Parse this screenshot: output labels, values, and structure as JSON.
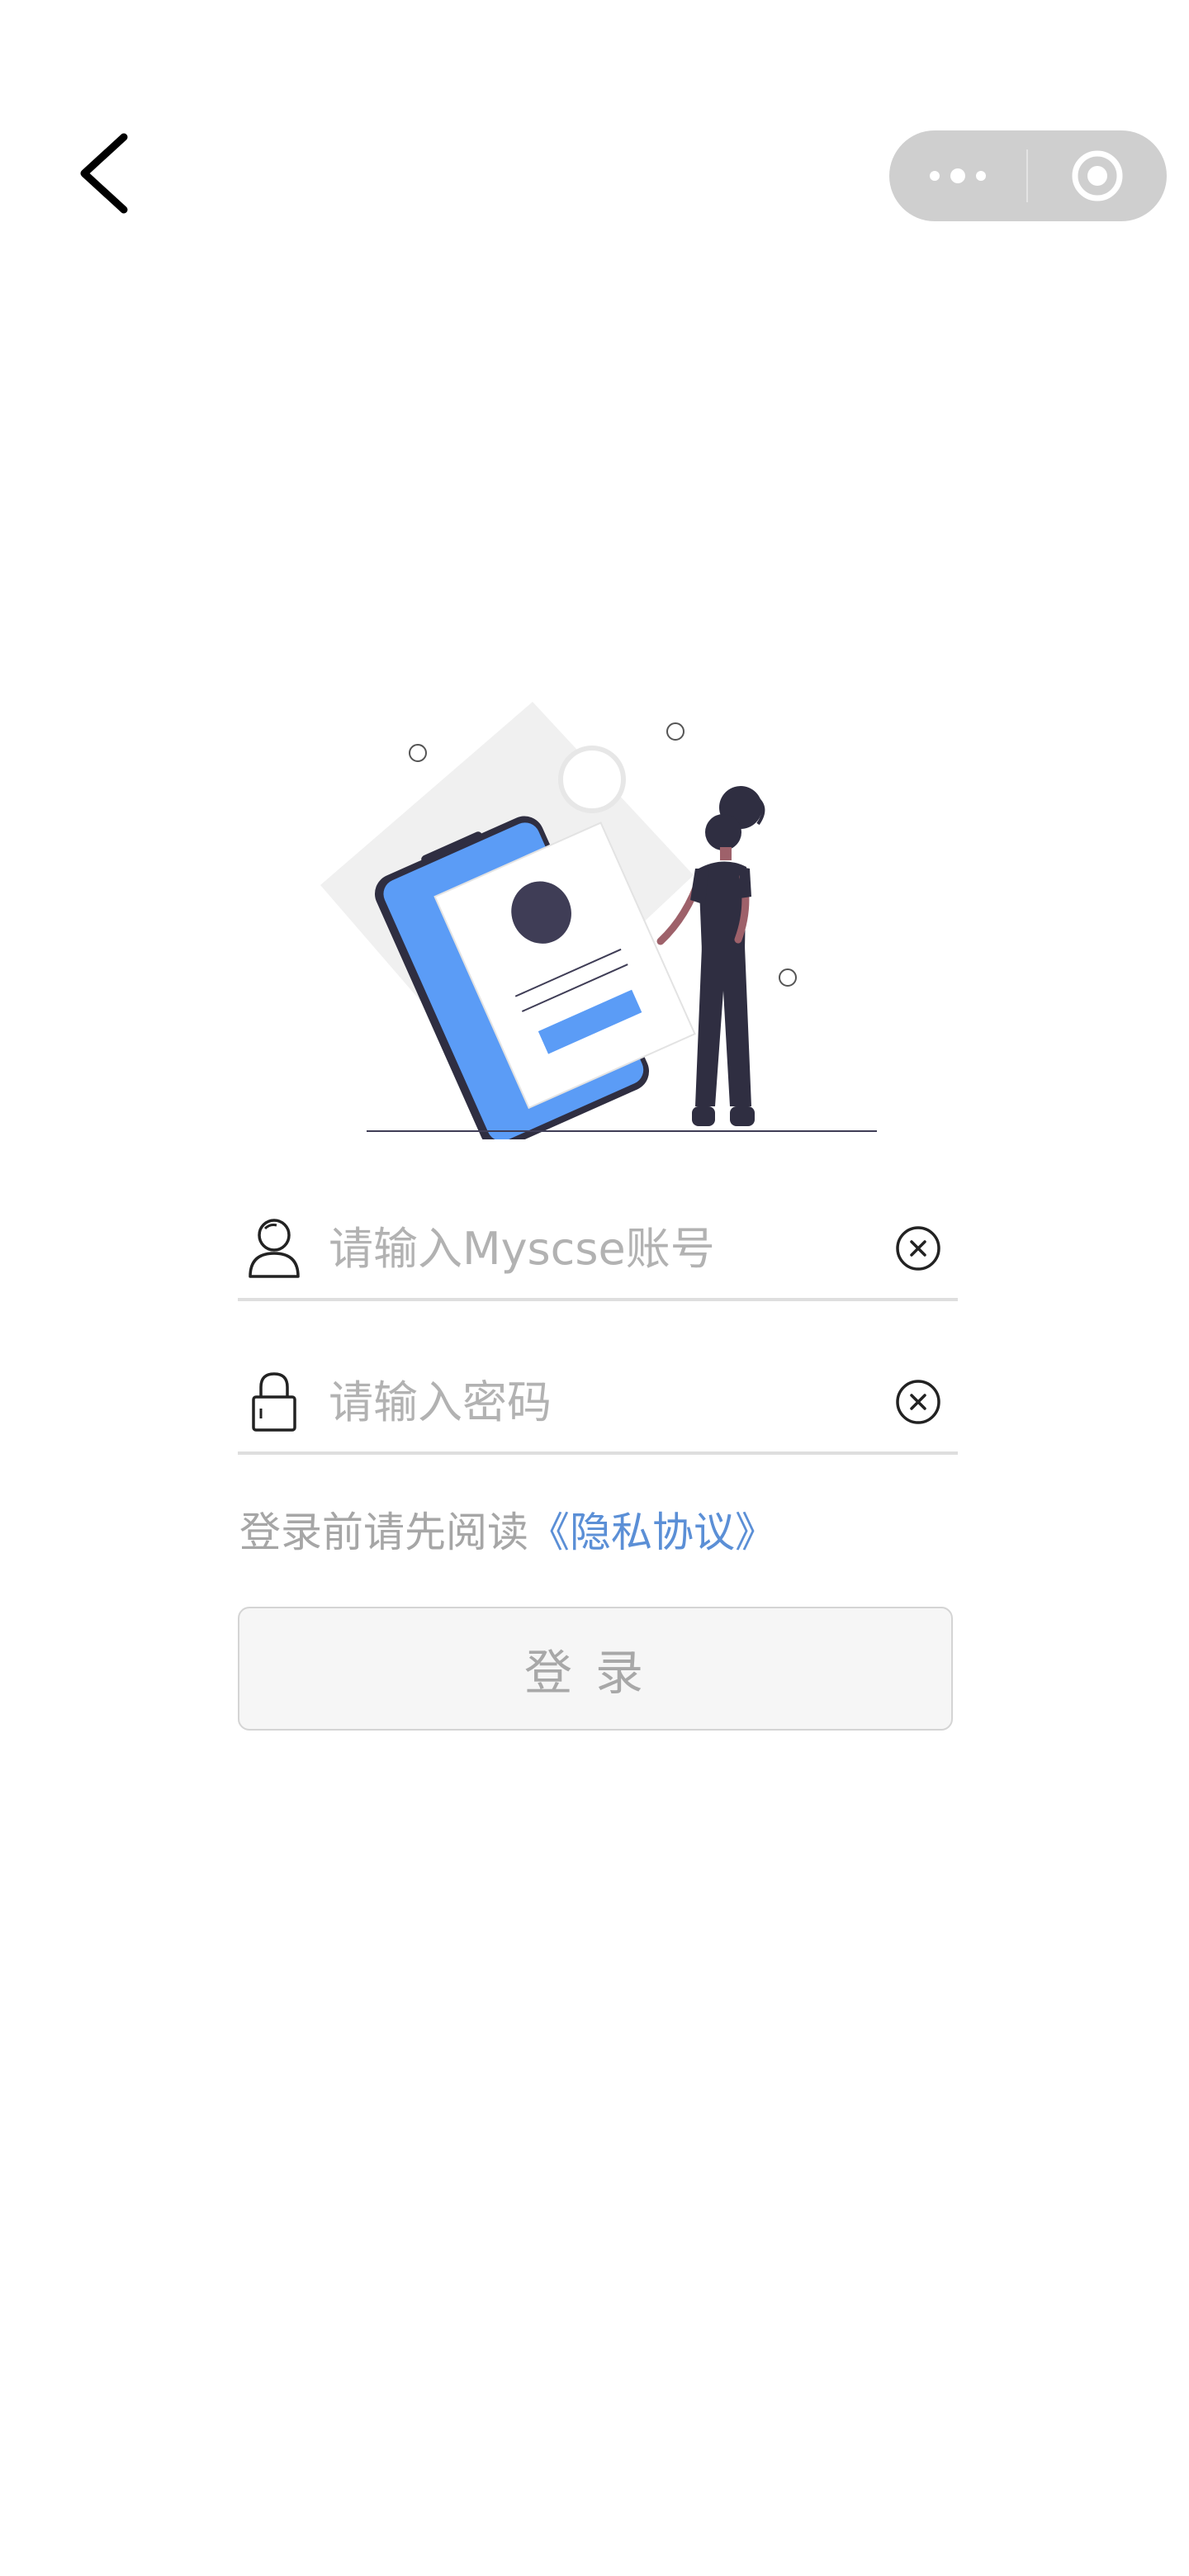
{
  "nav": {
    "back_icon": "chevron-left-icon",
    "more_icon": "more-dots-icon",
    "close_icon": "target-circle-icon",
    "capsule_color": "#cfcfcf"
  },
  "illustration": {
    "accent_color": "#5b9cf6",
    "dark_color": "#2f2e41"
  },
  "form": {
    "account": {
      "icon": "user-icon",
      "placeholder": "请输入Myscse账号",
      "value": "",
      "clear_icon": "clear-circle-x-icon"
    },
    "password": {
      "icon": "lock-icon",
      "placeholder": "请输入密码",
      "value": "",
      "clear_icon": "clear-circle-x-icon"
    },
    "privacy_prefix": "登录前请先阅读",
    "privacy_link": "《隐私协议》",
    "login_label": "登录"
  }
}
